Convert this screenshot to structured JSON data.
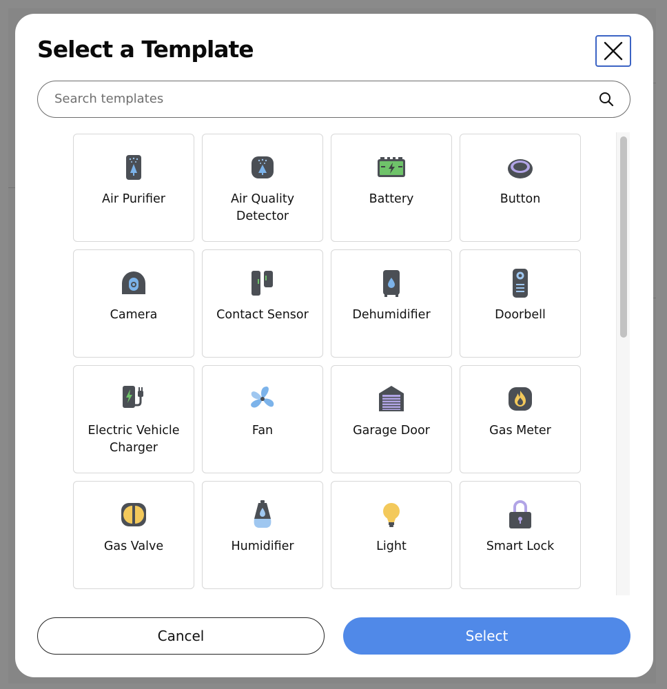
{
  "modal": {
    "title": "Select a Template",
    "search_placeholder": "Search templates",
    "cancel_label": "Cancel",
    "select_label": "Select"
  },
  "templates": [
    {
      "label": "Air Purifier",
      "icon": "air-purifier-icon"
    },
    {
      "label": "Air Quality Detector",
      "icon": "air-quality-detector-icon"
    },
    {
      "label": "Battery",
      "icon": "battery-icon"
    },
    {
      "label": "Button",
      "icon": "button-icon"
    },
    {
      "label": "Camera",
      "icon": "camera-icon"
    },
    {
      "label": "Contact Sensor",
      "icon": "contact-sensor-icon"
    },
    {
      "label": "Dehumidifier",
      "icon": "dehumidifier-icon"
    },
    {
      "label": "Doorbell",
      "icon": "doorbell-icon"
    },
    {
      "label": "Electric Vehicle Charger",
      "icon": "ev-charger-icon"
    },
    {
      "label": "Fan",
      "icon": "fan-icon"
    },
    {
      "label": "Garage Door",
      "icon": "garage-door-icon"
    },
    {
      "label": "Gas Meter",
      "icon": "gas-meter-icon"
    },
    {
      "label": "Gas Valve",
      "icon": "gas-valve-icon"
    },
    {
      "label": "Humidifier",
      "icon": "humidifier-icon"
    },
    {
      "label": "Light",
      "icon": "light-bulb-icon"
    },
    {
      "label": "Smart Lock",
      "icon": "smart-lock-icon"
    }
  ],
  "colors": {
    "accent": "#5089e8",
    "focus_border": "#3b63c4",
    "icon_dark": "#4b4f55",
    "icon_blue": "#7cb3ea",
    "icon_green": "#6fc36a",
    "icon_purple": "#b1a4e6",
    "icon_yellow": "#f3c95b"
  }
}
